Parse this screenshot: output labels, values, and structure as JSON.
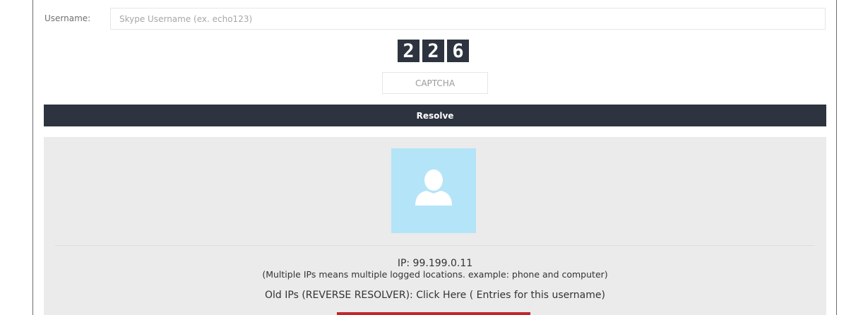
{
  "form": {
    "username_label": "Username:",
    "username_placeholder": "Skype Username (ex. echo123)",
    "username_value": "",
    "captcha_digits": [
      "2",
      "2",
      "6"
    ],
    "captcha_placeholder": "CAPTCHA",
    "resolve_label": "Resolve"
  },
  "result": {
    "avatar_icon": "user-silhouette-icon",
    "ip_text": "IP: 99.199.0.11",
    "multi_ip_note": "(Multiple IPs means multiple logged locations. example: phone and computer)",
    "old_ips_prefix": "Old IPs (REVERSE RESOLVER): ",
    "old_ips_link": "Click Here",
    "entries_text": " ( Entries for this username)"
  },
  "colors": {
    "dark": "#2d3440",
    "panel": "#ebebeb",
    "avatar_bg": "#b4e4f8",
    "accent_red": "#c0272d"
  }
}
